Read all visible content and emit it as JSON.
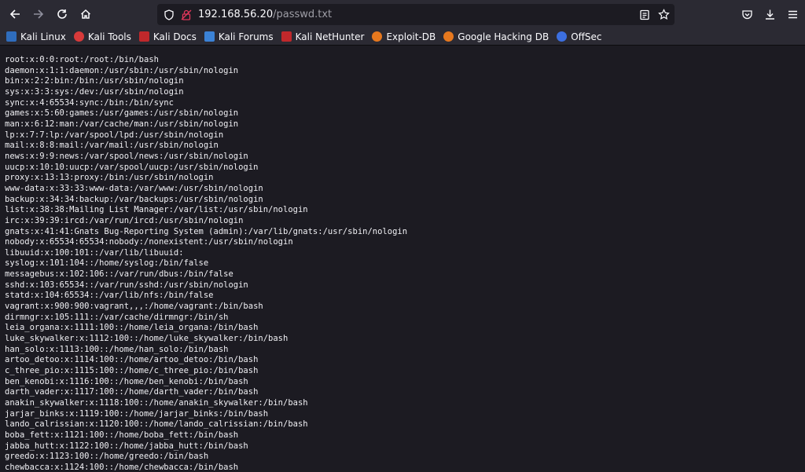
{
  "browser": {
    "url_host": "192.168.56.20",
    "url_path": "/passwd.txt"
  },
  "bookmarks": [
    {
      "label": "Kali Linux",
      "color": "#2f6dbd"
    },
    {
      "label": "Kali Tools",
      "color": "#d83a3a"
    },
    {
      "label": "Kali Docs",
      "color": "#c0282b"
    },
    {
      "label": "Kali Forums",
      "color": "#3b82d6"
    },
    {
      "label": "Kali NetHunter",
      "color": "#c0282b"
    },
    {
      "label": "Exploit-DB",
      "color": "#e6781e"
    },
    {
      "label": "Google Hacking DB",
      "color": "#e6781e"
    },
    {
      "label": "OffSec",
      "color": "#3c6fe0"
    }
  ],
  "lines": [
    "root:x:0:0:root:/root:/bin/bash",
    "daemon:x:1:1:daemon:/usr/sbin:/usr/sbin/nologin",
    "bin:x:2:2:bin:/bin:/usr/sbin/nologin",
    "sys:x:3:3:sys:/dev:/usr/sbin/nologin",
    "sync:x:4:65534:sync:/bin:/bin/sync",
    "games:x:5:60:games:/usr/games:/usr/sbin/nologin",
    "man:x:6:12:man:/var/cache/man:/usr/sbin/nologin",
    "lp:x:7:7:lp:/var/spool/lpd:/usr/sbin/nologin",
    "mail:x:8:8:mail:/var/mail:/usr/sbin/nologin",
    "news:x:9:9:news:/var/spool/news:/usr/sbin/nologin",
    "uucp:x:10:10:uucp:/var/spool/uucp:/usr/sbin/nologin",
    "proxy:x:13:13:proxy:/bin:/usr/sbin/nologin",
    "www-data:x:33:33:www-data:/var/www:/usr/sbin/nologin",
    "backup:x:34:34:backup:/var/backups:/usr/sbin/nologin",
    "list:x:38:38:Mailing List Manager:/var/list:/usr/sbin/nologin",
    "irc:x:39:39:ircd:/var/run/ircd:/usr/sbin/nologin",
    "gnats:x:41:41:Gnats Bug-Reporting System (admin):/var/lib/gnats:/usr/sbin/nologin",
    "nobody:x:65534:65534:nobody:/nonexistent:/usr/sbin/nologin",
    "libuuid:x:100:101::/var/lib/libuuid:",
    "syslog:x:101:104::/home/syslog:/bin/false",
    "messagebus:x:102:106::/var/run/dbus:/bin/false",
    "sshd:x:103:65534::/var/run/sshd:/usr/sbin/nologin",
    "statd:x:104:65534::/var/lib/nfs:/bin/false",
    "vagrant:x:900:900:vagrant,,,:/home/vagrant:/bin/bash",
    "dirmngr:x:105:111::/var/cache/dirmngr:/bin/sh",
    "leia_organa:x:1111:100::/home/leia_organa:/bin/bash",
    "luke_skywalker:x:1112:100::/home/luke_skywalker:/bin/bash",
    "han_solo:x:1113:100::/home/han_solo:/bin/bash",
    "artoo_detoo:x:1114:100::/home/artoo_detoo:/bin/bash",
    "c_three_pio:x:1115:100::/home/c_three_pio:/bin/bash",
    "ben_kenobi:x:1116:100::/home/ben_kenobi:/bin/bash",
    "darth_vader:x:1117:100::/home/darth_vader:/bin/bash",
    "anakin_skywalker:x:1118:100::/home/anakin_skywalker:/bin/bash",
    "jarjar_binks:x:1119:100::/home/jarjar_binks:/bin/bash",
    "lando_calrissian:x:1120:100::/home/lando_calrissian:/bin/bash",
    "boba_fett:x:1121:100::/home/boba_fett:/bin/bash",
    "jabba_hutt:x:1122:100::/home/jabba_hutt:/bin/bash",
    "greedo:x:1123:100::/home/greedo:/bin/bash",
    "chewbacca:x:1124:100::/home/chewbacca:/bin/bash"
  ]
}
